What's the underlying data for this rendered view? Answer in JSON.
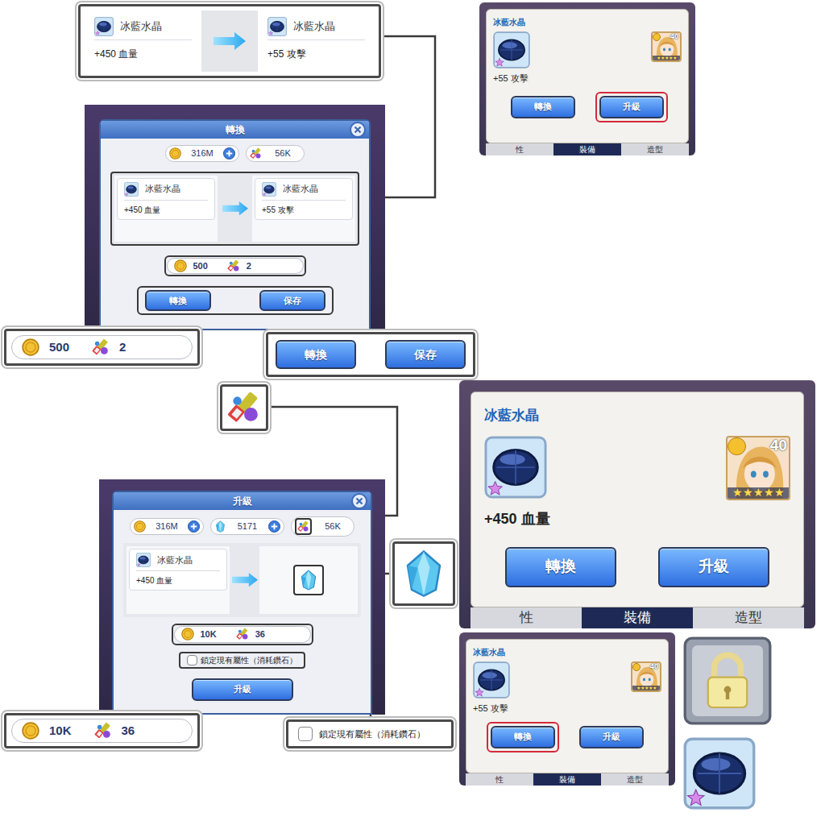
{
  "comparison_callout": {
    "from": {
      "name": "冰藍水晶",
      "stat": "+450 血量"
    },
    "to": {
      "name": "冰藍水晶",
      "stat": "+55 攻擊"
    }
  },
  "convert_dialog": {
    "title": "轉換",
    "currencies": [
      {
        "kind": "gold",
        "amount": "316M",
        "addable": true
      },
      {
        "kind": "tool",
        "amount": "56K",
        "addable": false
      }
    ],
    "from": {
      "name": "冰藍水晶",
      "stat": "+450 血量"
    },
    "to": {
      "name": "冰藍水晶",
      "stat": "+55 攻擊"
    },
    "cost": [
      {
        "kind": "gold",
        "amount": "500"
      },
      {
        "kind": "tool",
        "amount": "2"
      }
    ],
    "buttons": [
      "轉換",
      "保存"
    ]
  },
  "cost_callout": [
    {
      "kind": "gold",
      "amount": "500"
    },
    {
      "kind": "tool",
      "amount": "2"
    }
  ],
  "buttons_callout": [
    "轉換",
    "保存"
  ],
  "upgrade_dialog": {
    "title": "升級",
    "currencies": [
      {
        "kind": "gold",
        "amount": "316M",
        "addable": true
      },
      {
        "kind": "crystal",
        "amount": "5171",
        "addable": true
      },
      {
        "kind": "tool",
        "amount": "56K",
        "addable": false
      }
    ],
    "from": {
      "name": "冰藍水晶",
      "stat": "+450 血量"
    },
    "cost": [
      {
        "kind": "gold",
        "amount": "10K"
      },
      {
        "kind": "tool",
        "amount": "36"
      }
    ],
    "lock_option": {
      "label": "鎖定現有屬性（消耗鑽石）",
      "checked": false
    },
    "buttons": [
      "升級"
    ]
  },
  "upgrade_cost_callout": [
    {
      "kind": "gold",
      "amount": "10K"
    },
    {
      "kind": "tool",
      "amount": "36"
    }
  ],
  "lock_option_callout": {
    "label": "鎖定現有屬性（消耗鑽石）",
    "checked": false
  },
  "item_panels": [
    {
      "kind": "compact",
      "title": "冰藍水晶",
      "stat": "+55 攻擊",
      "level": "40",
      "stars": 5,
      "buttons": [
        {
          "label": "轉換",
          "highlighted": false
        },
        {
          "label": "升級",
          "highlighted": true
        }
      ],
      "tabs": [
        {
          "label": "性",
          "selected": false
        },
        {
          "label": "裝備",
          "selected": true
        },
        {
          "label": "造型",
          "selected": false
        }
      ]
    },
    {
      "kind": "large",
      "title": "冰藍水晶",
      "stat": "+450 血量",
      "level": "40",
      "stars": 5,
      "buttons": [
        {
          "label": "轉換",
          "highlighted": false
        },
        {
          "label": "升級",
          "highlighted": false
        }
      ],
      "tabs": [
        {
          "label": "性",
          "selected": false
        },
        {
          "label": "裝備",
          "selected": true
        },
        {
          "label": "造型",
          "selected": false
        }
      ]
    },
    {
      "kind": "compact",
      "title": "冰藍水晶",
      "stat": "+55 攻擊",
      "level": "40",
      "stars": 5,
      "buttons": [
        {
          "label": "轉換",
          "highlighted": true
        },
        {
          "label": "升級",
          "highlighted": false
        }
      ],
      "tabs": [
        {
          "label": "性",
          "selected": false
        },
        {
          "label": "裝備",
          "selected": true
        },
        {
          "label": "造型",
          "selected": false
        }
      ]
    }
  ]
}
